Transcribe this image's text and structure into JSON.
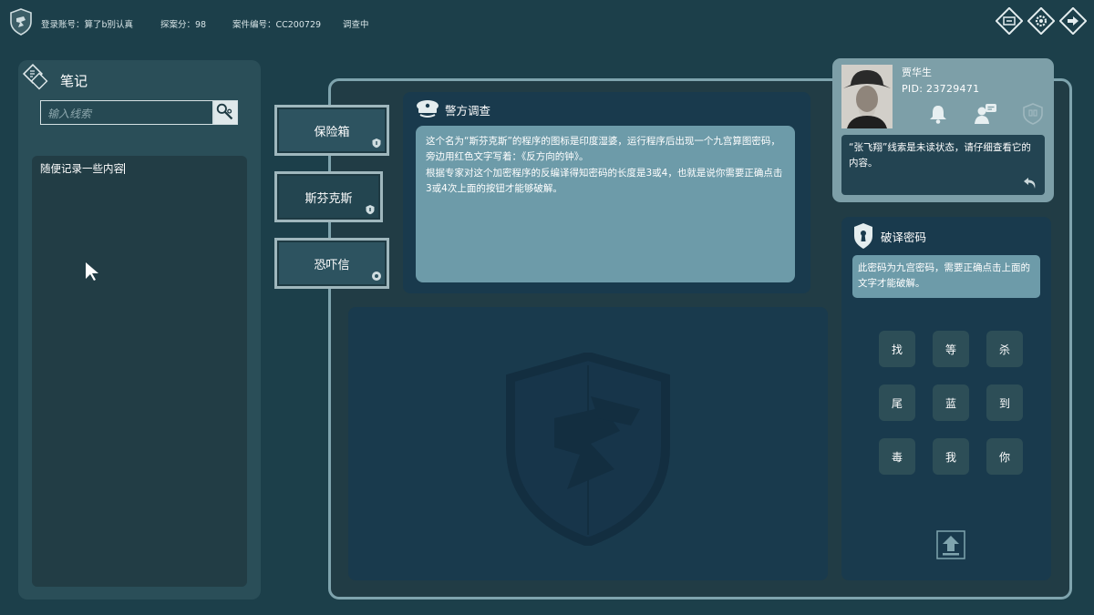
{
  "topbar": {
    "account": "登录账号：算了b别认真",
    "score": "探案分：98",
    "case_no": "案件编号：CC200729",
    "status": "调查中"
  },
  "notes": {
    "title": "笔记",
    "search_placeholder": "输入线索",
    "content": "随便记录一些内容"
  },
  "clues": [
    {
      "label": "保险箱"
    },
    {
      "label": "斯芬克斯"
    },
    {
      "label": "恐吓信"
    }
  ],
  "police": {
    "title": "警方调查",
    "paragraph1": "这个名为“斯芬克斯”的程序的图标是印度湿婆，运行程序后出现一个九宫算图密码，旁边用红色文字写着：《反方向的钟》。",
    "paragraph2": "根据专家对这个加密程序的反编译得知密码的长度是3或4，也就是说你需要正确点击3或4次上面的按钮才能够破解。"
  },
  "profile": {
    "name": "贾华生",
    "pid": "PID: 23729471",
    "message": "“张飞翔”线索是未读状态，请仔细查看它的内容。"
  },
  "decrypt": {
    "title": "破译密码",
    "hint": "此密码为九宫密码，需要正确点击上面的文字才能破解。",
    "keys": [
      "找",
      "等",
      "杀",
      "尾",
      "蓝",
      "到",
      "毒",
      "我",
      "你"
    ]
  },
  "colors": {
    "background": "#1c3f4a",
    "panel_dark": "#193a4d",
    "panel_text": "#6d9ba9",
    "frame_border": "#7fa4ae"
  }
}
